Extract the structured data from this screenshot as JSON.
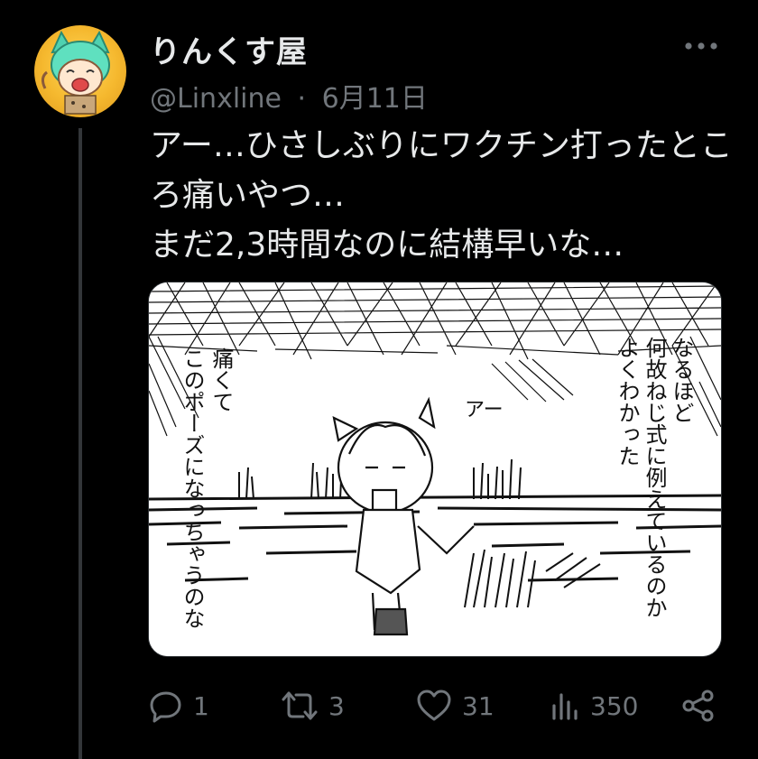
{
  "tweet": {
    "display_name": "りんくす屋",
    "handle": "@Linxline",
    "separator": "·",
    "date": "6月11日",
    "text_lines": [
      "アー…ひさしぶりにワクチン打ったとこ",
      "ろ痛いやつ…",
      "まだ2,3時間なのに結構早いな…"
    ],
    "image": {
      "left_caption_lines": [
        "痛くて",
        "このポーズになっちゃうのな"
      ],
      "right_caption_lines": [
        "なるほど",
        "何故ねじ式に例えているのか",
        "よくわかった"
      ],
      "sfx": "アー"
    },
    "actions": {
      "reply_count": "1",
      "retweet_count": "3",
      "like_count": "31",
      "view_count": "350"
    }
  },
  "icons": {
    "more": "more-horizontal-icon",
    "reply": "reply-icon",
    "retweet": "retweet-icon",
    "like": "heart-icon",
    "views": "views-icon",
    "share": "share-icon"
  },
  "colors": {
    "background": "#000000",
    "text_primary": "#e7e9ea",
    "text_secondary": "#71767b",
    "thread_line": "#333639"
  }
}
